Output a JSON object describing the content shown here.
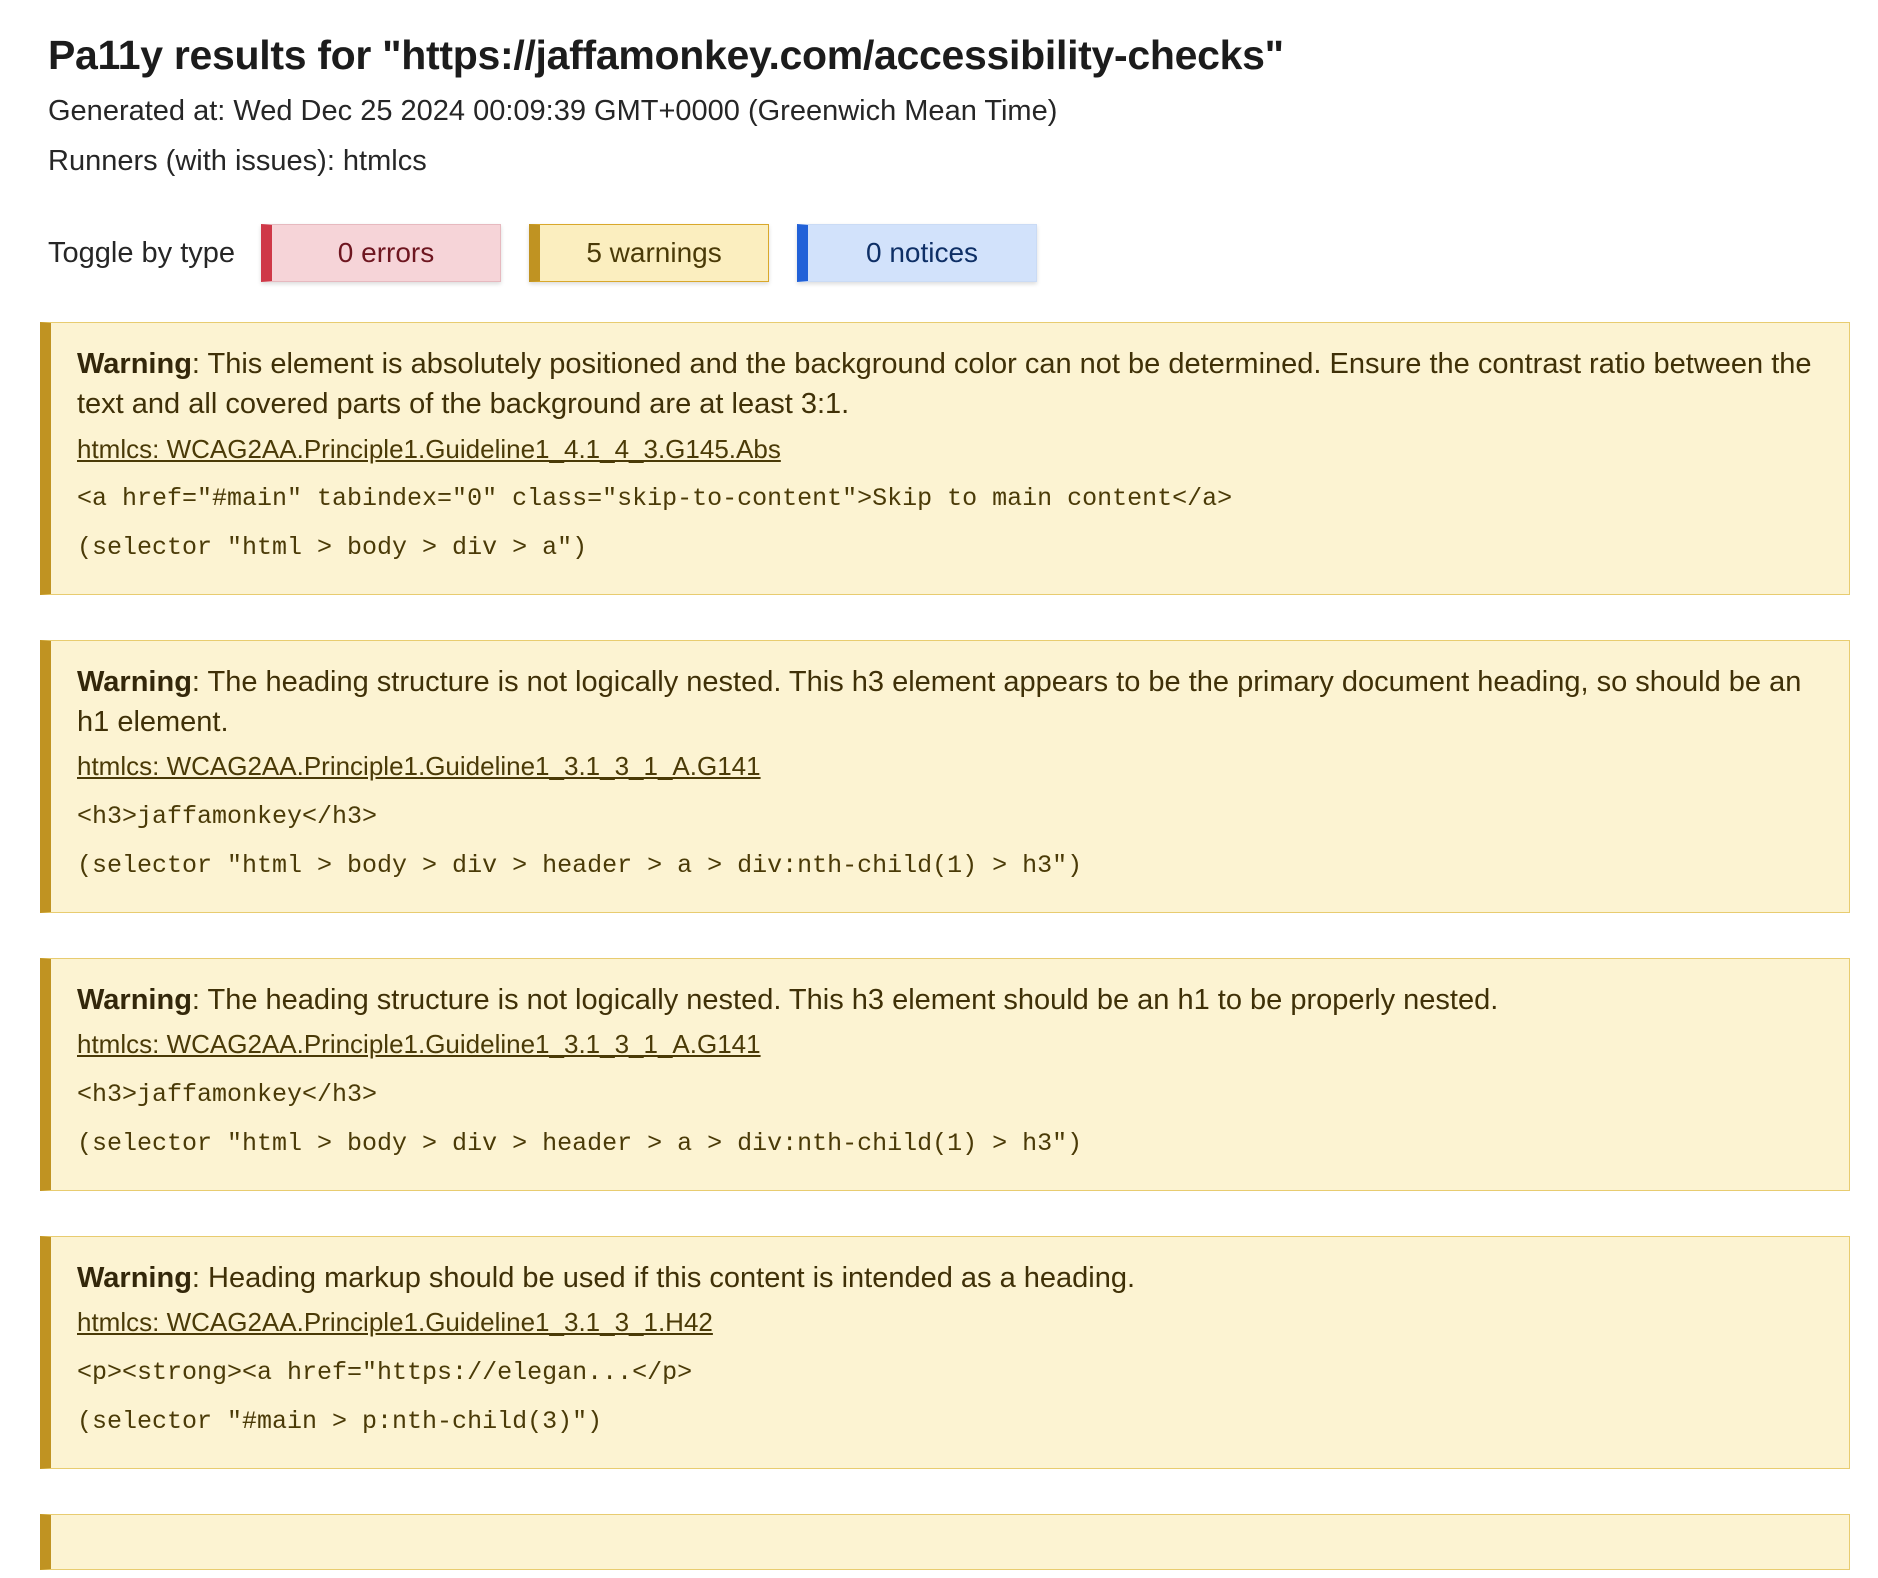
{
  "header": {
    "title": "Pa11y results for \"https://jaffamonkey.com/accessibility-checks\"",
    "generated_at": "Generated at: Wed Dec 25 2024 00:09:39 GMT+0000 (Greenwich Mean Time)",
    "runners": "Runners (with issues): htmlcs"
  },
  "toggle": {
    "label": "Toggle by type",
    "buttons": [
      {
        "id": "errors",
        "label": "0 errors",
        "count": 0,
        "accent": "#cf3847",
        "background": "#f6d4d8"
      },
      {
        "id": "warnings",
        "label": "5 warnings",
        "count": 5,
        "accent": "#c09322",
        "background": "#fbeebf"
      },
      {
        "id": "notices",
        "label": "0 notices",
        "count": 0,
        "accent": "#2161d8",
        "background": "#d2e2fb"
      }
    ]
  },
  "issues": [
    {
      "type_label": "Warning",
      "message": ": This element is absolutely positioned and the background color can not be determined. Ensure the contrast ratio between the text and all covered parts of the background are at least 3:1.",
      "code": "htmlcs: WCAG2AA.Principle1.Guideline1_4.1_4_3.G145.Abs",
      "context": "<a href=\"#main\" tabindex=\"0\" class=\"skip-to-content\">Skip to main content</a>",
      "selector": "(selector \"html > body > div > a\")"
    },
    {
      "type_label": "Warning",
      "message": ": The heading structure is not logically nested. This h3 element appears to be the primary document heading, so should be an h1 element.",
      "code": "htmlcs: WCAG2AA.Principle1.Guideline1_3.1_3_1_A.G141",
      "context": "<h3>jaffamonkey</h3>",
      "selector": "(selector \"html > body > div > header > a > div:nth-child(1) > h3\")"
    },
    {
      "type_label": "Warning",
      "message": ": The heading structure is not logically nested. This h3 element should be an h1 to be properly nested.",
      "code": "htmlcs: WCAG2AA.Principle1.Guideline1_3.1_3_1_A.G141",
      "context": "<h3>jaffamonkey</h3>",
      "selector": "(selector \"html > body > div > header > a > div:nth-child(1) > h3\")"
    },
    {
      "type_label": "Warning",
      "message": ": Heading markup should be used if this content is intended as a heading.",
      "code": "htmlcs: WCAG2AA.Principle1.Guideline1_3.1_3_1.H42",
      "context": "<p><strong><a href=\"https://elegan...</p>",
      "selector": "(selector \"#main > p:nth-child(3)\")"
    }
  ]
}
